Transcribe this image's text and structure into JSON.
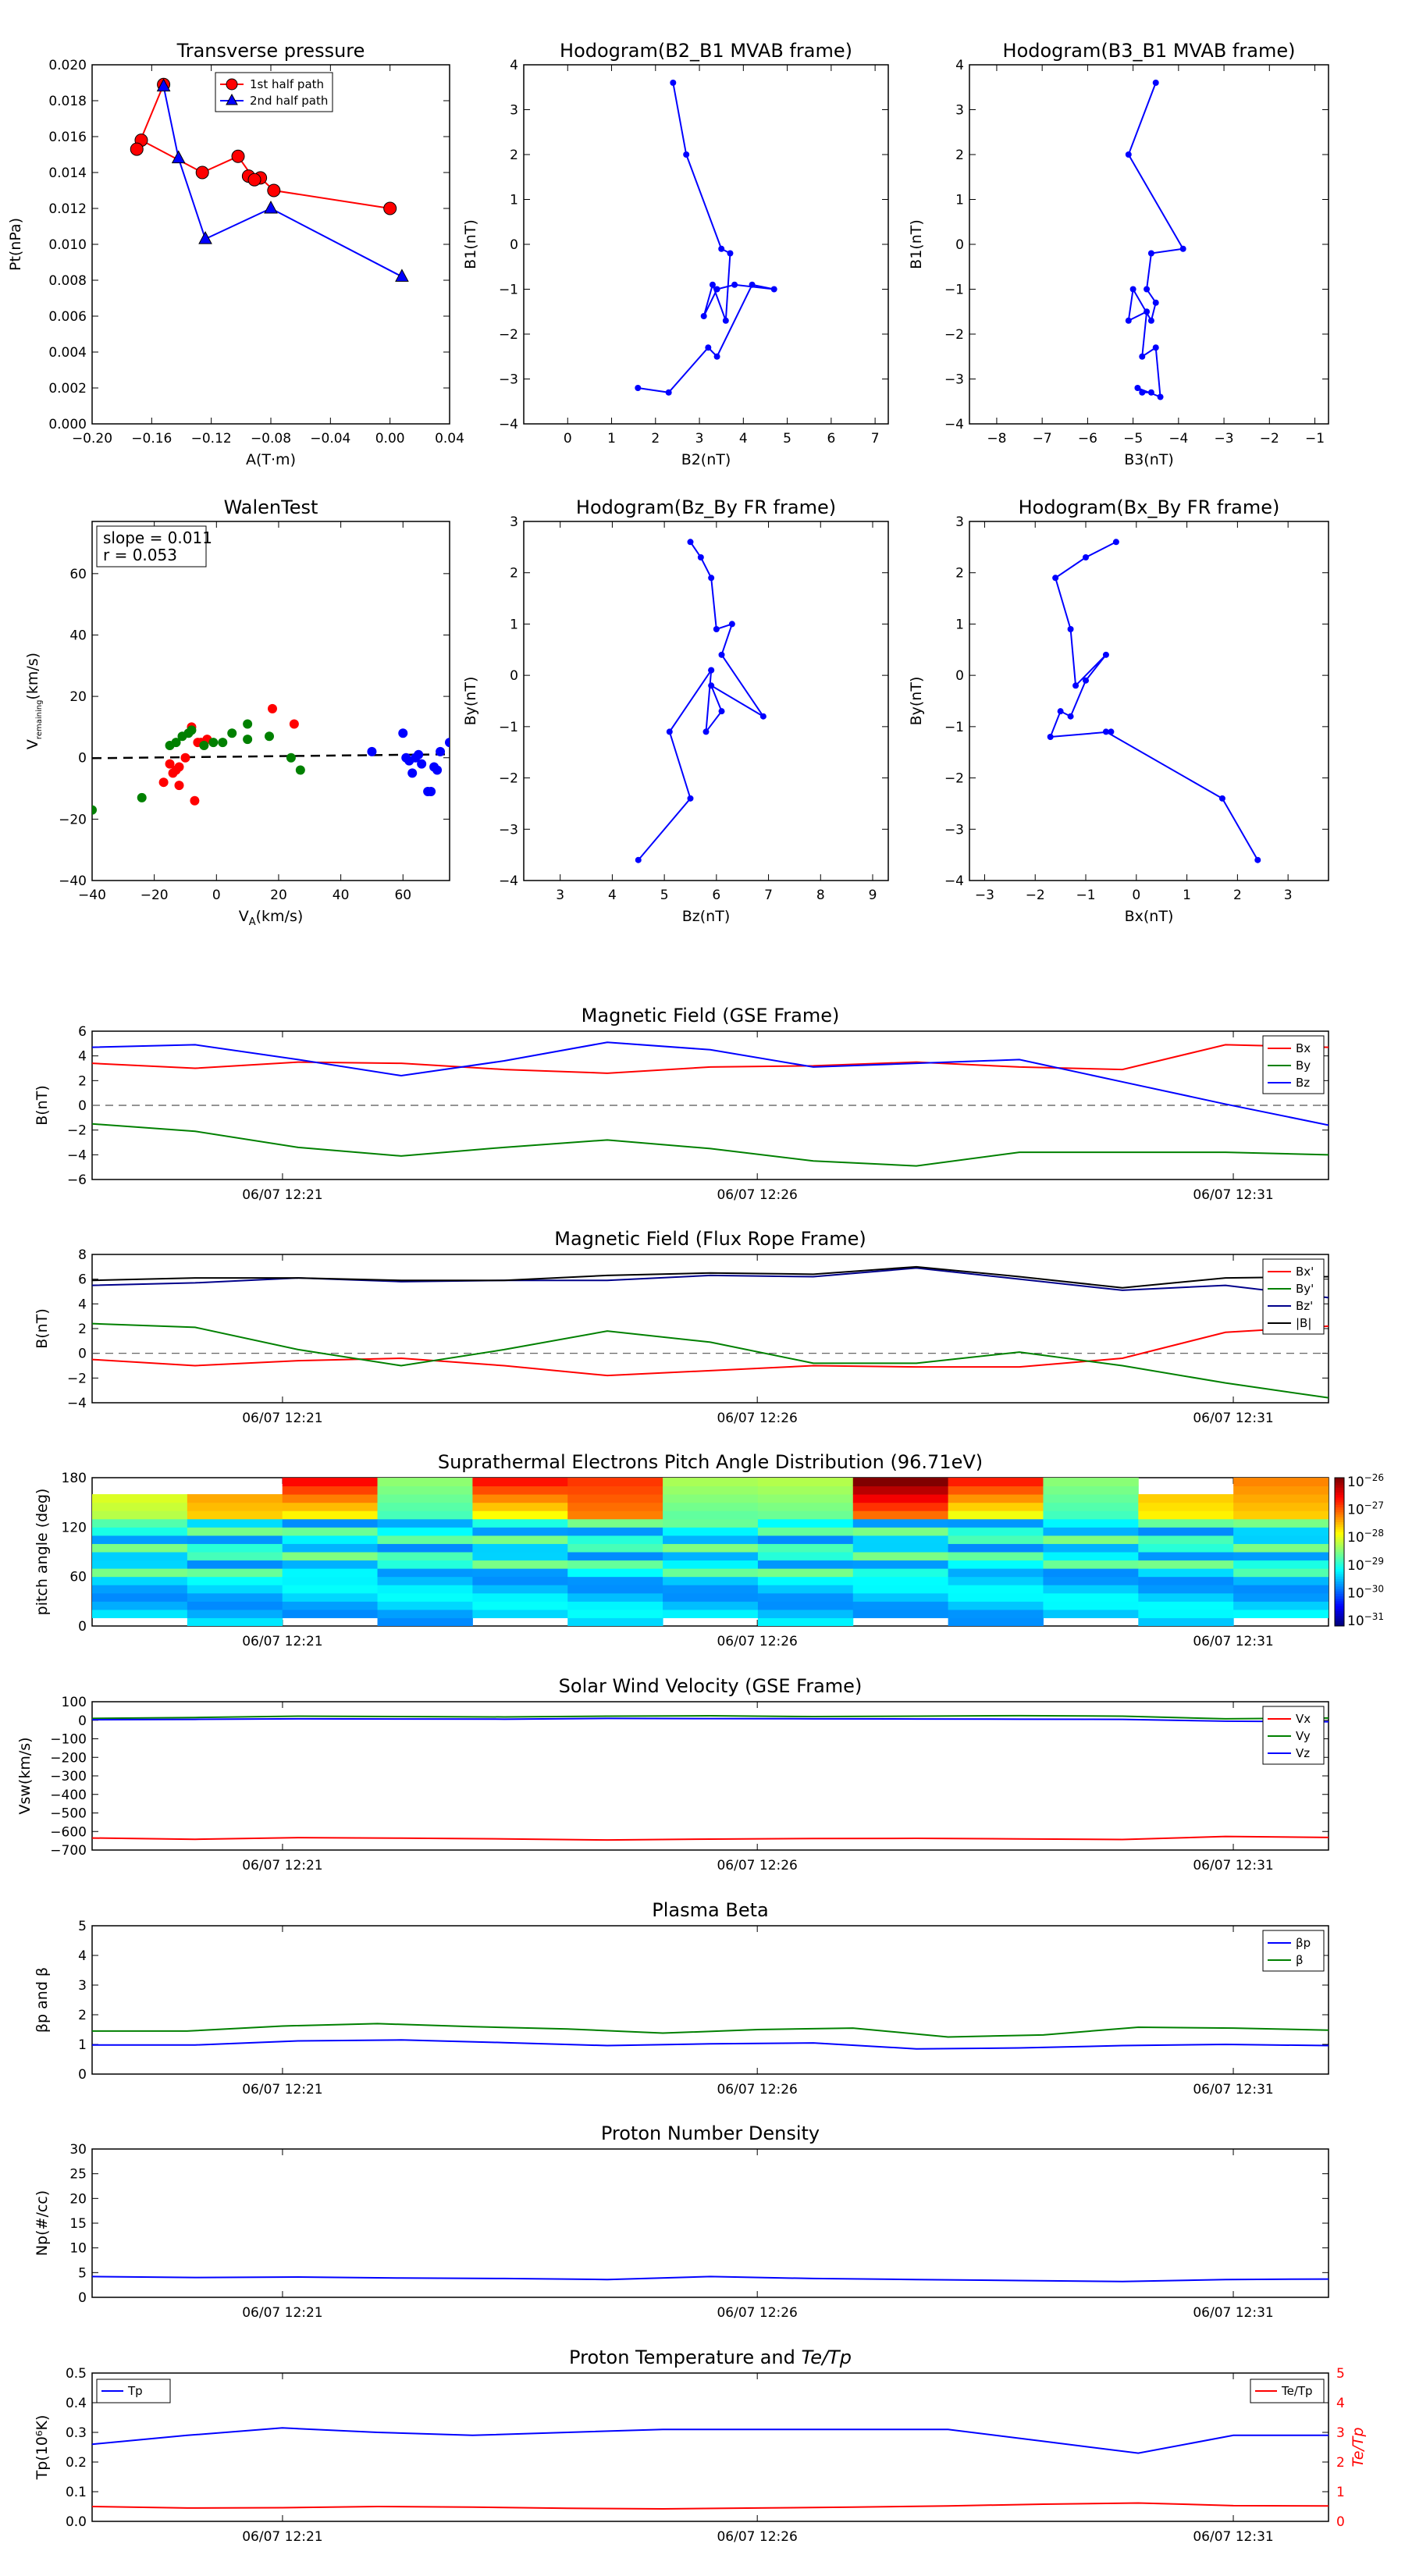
{
  "chart_data": [
    {
      "id": "tp",
      "type": "line",
      "title": "Transverse pressure",
      "xlabel": "A(T·m)",
      "ylabel": "Pt(nPa)",
      "xlim": [
        -0.2,
        0.04
      ],
      "ylim": [
        0,
        0.02
      ],
      "xticks": [
        "−0.20",
        "−0.16",
        "−0.12",
        "−0.08",
        "−0.04",
        "0.00",
        "0.04"
      ],
      "yticks": [
        "0.000",
        "0.002",
        "0.004",
        "0.006",
        "0.008",
        "0.010",
        "0.012",
        "0.014",
        "0.016",
        "0.018",
        "0.020"
      ],
      "legend": [
        "1st half path",
        "2nd half path"
      ],
      "series": [
        {
          "name": "1st half path",
          "color": "#ff0000",
          "marker": "circle",
          "x": [
            0.0,
            -0.078,
            -0.087,
            -0.095,
            -0.091,
            -0.102,
            -0.126,
            -0.167,
            -0.17,
            -0.152
          ],
          "y": [
            0.012,
            0.013,
            0.0137,
            0.0138,
            0.0136,
            0.0149,
            0.014,
            0.0158,
            0.0153,
            0.0189
          ]
        },
        {
          "name": "2nd half path",
          "color": "#0000ff",
          "marker": "triangle",
          "x": [
            -0.152,
            -0.142,
            -0.124,
            -0.08,
            0.008
          ],
          "y": [
            0.0188,
            0.0148,
            0.0103,
            0.012,
            0.0082
          ]
        }
      ]
    },
    {
      "id": "h1",
      "type": "line",
      "title": "Hodogram(B2_B1 MVAB frame)",
      "xlabel": "B2(nT)",
      "ylabel": "B1(nT)",
      "xlim": [
        -1,
        7.3
      ],
      "ylim": [
        -4,
        4
      ],
      "xticks": [
        "0",
        "1",
        "2",
        "3",
        "4",
        "5",
        "6",
        "7"
      ],
      "yticks": [
        "−4",
        "−3",
        "−2",
        "−1",
        "0",
        "1",
        "2",
        "3",
        "4"
      ],
      "series": [
        {
          "color": "#0000ff",
          "x": [
            2.4,
            2.7,
            3.5,
            3.7,
            3.6,
            3.3,
            3.1,
            3.4,
            3.8,
            4.7,
            4.2,
            3.4,
            3.2,
            2.3,
            1.6
          ],
          "y": [
            3.6,
            2.0,
            -0.1,
            -0.2,
            -1.7,
            -0.9,
            -1.6,
            -1.0,
            -0.9,
            -1.0,
            -0.9,
            -2.5,
            -2.3,
            -3.3,
            -3.2
          ]
        }
      ]
    },
    {
      "id": "h2",
      "type": "line",
      "title": "Hodogram(B3_B1 MVAB frame)",
      "xlabel": "B3(nT)",
      "ylabel": "B1(nT)",
      "xlim": [
        -8.6,
        -0.7
      ],
      "ylim": [
        -4,
        4
      ],
      "xticks": [
        "−8",
        "−7",
        "−6",
        "−5",
        "−4",
        "−3",
        "−2",
        "−1"
      ],
      "yticks": [
        "−4",
        "−3",
        "−2",
        "−1",
        "0",
        "1",
        "2",
        "3",
        "4"
      ],
      "series": [
        {
          "color": "#0000ff",
          "x": [
            -4.5,
            -5.1,
            -3.9,
            -4.6,
            -4.7,
            -4.5,
            -4.6,
            -5.0,
            -5.1,
            -4.7,
            -4.8,
            -4.5,
            -4.4,
            -4.9,
            -4.8,
            -4.6
          ],
          "y": [
            3.6,
            2.0,
            -0.1,
            -0.2,
            -1.0,
            -1.3,
            -1.7,
            -1.0,
            -1.7,
            -1.5,
            -2.5,
            -2.3,
            -3.4,
            -3.2,
            -3.3,
            -3.3
          ]
        }
      ]
    },
    {
      "id": "walen",
      "type": "scatter",
      "title": "WalenTest",
      "xlabel": "V",
      "xlabel_sub": "A",
      "xlabel_unit": "(km/s)",
      "ylabel": "V",
      "ylabel_sub": "remaining",
      "ylabel_unit": "(km/s)",
      "annotations": [
        "slope = 0.011",
        "r = 0.053"
      ],
      "xlim": [
        -40,
        75
      ],
      "ylim": [
        -40,
        77
      ],
      "xticks": [
        "−40",
        "−20",
        "0",
        "20",
        "40",
        "60"
      ],
      "yticks": [
        "−40",
        "−20",
        "0",
        "20",
        "40",
        "60"
      ],
      "fit": {
        "slope": 0.011,
        "intercept": 0.3
      },
      "series": [
        {
          "color": "#ff0000",
          "x": [
            -8,
            -17,
            -12,
            -14,
            -13,
            -15,
            -12,
            -10,
            -7,
            -5,
            -6,
            -3,
            18,
            25
          ],
          "y": [
            10,
            -8,
            -3,
            -5,
            -4,
            -2,
            -9,
            0,
            -14,
            5,
            5,
            6,
            16,
            11
          ]
        },
        {
          "color": "#008000",
          "x": [
            -40,
            -24,
            -15,
            -13,
            -11,
            -9,
            -8,
            -4,
            -1,
            2,
            5,
            10,
            10,
            17,
            24,
            27
          ],
          "y": [
            -17,
            -13,
            4,
            5,
            7,
            8,
            9,
            4,
            5,
            5,
            8,
            11,
            6,
            7,
            0,
            -4
          ]
        },
        {
          "color": "#0000ff",
          "x": [
            50,
            60,
            61,
            62,
            63,
            64,
            65,
            66,
            68,
            69,
            70,
            71,
            72,
            75,
            76
          ],
          "y": [
            2,
            8,
            0,
            -1,
            -5,
            0,
            1,
            -2,
            -11,
            -11,
            -3,
            -4,
            2,
            5,
            5
          ]
        }
      ]
    },
    {
      "id": "h3",
      "type": "line",
      "title": "Hodogram(Bz_By FR frame)",
      "xlabel": "Bz(nT)",
      "ylabel": "By(nT)",
      "xlim": [
        2.3,
        9.3
      ],
      "ylim": [
        -4,
        3
      ],
      "xticks": [
        "3",
        "4",
        "5",
        "6",
        "7",
        "8",
        "9"
      ],
      "yticks": [
        "−4",
        "−3",
        "−2",
        "−1",
        "0",
        "1",
        "2",
        "3"
      ],
      "series": [
        {
          "color": "#0000ff",
          "x": [
            5.5,
            5.7,
            5.9,
            6.0,
            6.3,
            6.1,
            6.9,
            5.9,
            6.1,
            5.8,
            5.9,
            5.9,
            5.1,
            5.5,
            4.5
          ],
          "y": [
            2.6,
            2.3,
            1.9,
            0.9,
            1.0,
            0.4,
            -0.8,
            -0.2,
            -0.7,
            -1.1,
            0.1,
            0.1,
            -1.1,
            -2.4,
            -3.6
          ]
        }
      ]
    },
    {
      "id": "h4",
      "type": "line",
      "title": "Hodogram(Bx_By FR frame)",
      "xlabel": "Bx(nT)",
      "ylabel": "By(nT)",
      "xlim": [
        -3.3,
        3.8
      ],
      "ylim": [
        -4,
        3
      ],
      "xticks": [
        "−3",
        "−2",
        "−1",
        "0",
        "1",
        "2",
        "3"
      ],
      "yticks": [
        "−4",
        "−3",
        "−2",
        "−1",
        "0",
        "1",
        "2",
        "3"
      ],
      "series": [
        {
          "color": "#0000ff",
          "x": [
            -0.4,
            -1.0,
            -1.6,
            -1.3,
            -1.2,
            -0.6,
            -1.0,
            -1.3,
            -1.5,
            -1.7,
            -0.5,
            -0.6,
            1.7,
            2.4
          ],
          "y": [
            2.6,
            2.3,
            1.9,
            0.9,
            -0.2,
            0.4,
            -0.1,
            -0.8,
            -0.7,
            -1.2,
            -1.1,
            -1.1,
            -2.4,
            -3.6
          ]
        }
      ]
    },
    {
      "id": "mag_gse",
      "type": "line",
      "title": "Magnetic Field (GSE Frame)",
      "ylabel": "B(nT)",
      "ylim": [
        -6,
        6
      ],
      "yticks": [
        "−6",
        "−4",
        "−2",
        "0",
        "2",
        "4",
        "6"
      ],
      "xticks": [
        "06/07 12:21",
        "06/07 12:26",
        "06/07 12:31"
      ],
      "zeroline": true,
      "legend": [
        "Bx",
        "By",
        "Bz"
      ],
      "series": [
        {
          "name": "Bx",
          "color": "#ff0000",
          "y": [
            3.4,
            3.0,
            3.5,
            3.4,
            2.9,
            2.6,
            3.1,
            3.2,
            3.5,
            3.1,
            2.9,
            4.9,
            4.7
          ]
        },
        {
          "name": "By",
          "color": "#008000",
          "y": [
            -1.5,
            -2.1,
            -3.4,
            -4.1,
            -3.4,
            -2.8,
            -3.5,
            -4.5,
            -4.9,
            -3.8,
            -3.8,
            -3.8,
            -4.0
          ]
        },
        {
          "name": "Bz",
          "color": "#0000ff",
          "y": [
            4.7,
            4.9,
            3.7,
            2.4,
            3.6,
            5.1,
            4.5,
            3.1,
            3.4,
            3.7,
            1.9,
            0.1,
            -1.6
          ]
        }
      ]
    },
    {
      "id": "mag_fr",
      "type": "line",
      "title": "Magnetic Field (Flux Rope Frame)",
      "ylabel": "B(nT)",
      "ylim": [
        -4,
        8
      ],
      "yticks": [
        "−4",
        "−2",
        "0",
        "2",
        "4",
        "6",
        "8"
      ],
      "xticks": [
        "06/07 12:21",
        "06/07 12:26",
        "06/07 12:31"
      ],
      "zeroline": true,
      "legend": [
        "Bx'",
        "By'",
        "Bz'",
        "|B|"
      ],
      "series": [
        {
          "name": "Bx'",
          "color": "#ff0000",
          "y": [
            -0.5,
            -1.0,
            -0.6,
            -0.4,
            -1.0,
            -1.8,
            -1.4,
            -1.0,
            -1.1,
            -1.1,
            -0.4,
            1.7,
            2.2
          ]
        },
        {
          "name": "By'",
          "color": "#008000",
          "y": [
            2.4,
            2.1,
            0.3,
            -1.0,
            0.3,
            1.8,
            0.9,
            -0.8,
            -0.8,
            0.1,
            -1.0,
            -2.4,
            -3.6
          ]
        },
        {
          "name": "Bz'",
          "color": "#00008b",
          "y": [
            5.5,
            5.7,
            6.1,
            5.8,
            5.9,
            5.9,
            6.3,
            6.2,
            6.9,
            6.0,
            5.1,
            5.5,
            4.5
          ]
        },
        {
          "name": "|B|",
          "color": "#000000",
          "y": [
            5.9,
            6.1,
            6.1,
            5.9,
            5.9,
            6.3,
            6.5,
            6.4,
            7.0,
            6.2,
            5.3,
            6.1,
            6.2
          ]
        }
      ]
    },
    {
      "id": "pad",
      "type": "heatmap",
      "title": "Suprathermal Electrons Pitch Angle Distribution (96.71eV)",
      "ylabel": "pitch angle (deg)",
      "ylim": [
        0,
        180
      ],
      "yticks": [
        "0",
        "60",
        "120",
        "180"
      ],
      "xticks": [
        "06/07 12:21",
        "06/07 12:26",
        "06/07 12:31"
      ],
      "colorbar": {
        "base": "10",
        "exponents": [
          "−26",
          "−27",
          "−28",
          "−29",
          "−30",
          "−31"
        ]
      },
      "columns": 13,
      "rows": 18
    },
    {
      "id": "vsw",
      "type": "line",
      "title": "Solar Wind Velocity (GSE Frame)",
      "ylabel": "Vsw(km/s)",
      "ylim": [
        -700,
        100
      ],
      "yticks": [
        "−700",
        "−600",
        "−500",
        "−400",
        "−300",
        "−200",
        "−100",
        "0",
        "100"
      ],
      "xticks": [
        "06/07 12:21",
        "06/07 12:26",
        "06/07 12:31"
      ],
      "legend": [
        "Vx",
        "Vy",
        "Vz"
      ],
      "series": [
        {
          "name": "Vx",
          "color": "#ff0000",
          "y": [
            -635,
            -642,
            -633,
            -636,
            -640,
            -646,
            -641,
            -638,
            -637,
            -640,
            -643,
            -627,
            -632
          ]
        },
        {
          "name": "Vy",
          "color": "#008000",
          "y": [
            10,
            15,
            22,
            20,
            18,
            22,
            24,
            20,
            22,
            25,
            22,
            8,
            12
          ]
        },
        {
          "name": "Vz",
          "color": "#0000ff",
          "y": [
            3,
            5,
            8,
            7,
            6,
            10,
            9,
            8,
            7,
            6,
            5,
            -5,
            -8
          ]
        }
      ]
    },
    {
      "id": "beta",
      "type": "line",
      "title": "Plasma Beta",
      "ylabel": "βp and β",
      "ylim": [
        0,
        5
      ],
      "yticks": [
        "0",
        "1",
        "2",
        "3",
        "4",
        "5"
      ],
      "xticks": [
        "06/07 12:21",
        "06/07 12:26",
        "06/07 12:31"
      ],
      "legend": [
        "βp",
        "β"
      ],
      "series": [
        {
          "name": "βp",
          "color": "#0000ff",
          "y": [
            0.98,
            0.98,
            1.12,
            1.15,
            1.06,
            0.96,
            1.02,
            1.05,
            0.85,
            0.88,
            0.96,
            1.0,
            0.96
          ]
        },
        {
          "name": "β",
          "color": "#008000",
          "y": [
            1.45,
            1.45,
            1.62,
            1.7,
            1.6,
            1.52,
            1.38,
            1.5,
            1.55,
            1.25,
            1.32,
            1.58,
            1.55,
            1.48
          ]
        }
      ]
    },
    {
      "id": "np",
      "type": "line",
      "title": "Proton Number Density",
      "ylabel": "Np(#/cc)",
      "ylim": [
        0,
        30
      ],
      "yticks": [
        "0",
        "5",
        "10",
        "15",
        "20",
        "25",
        "30"
      ],
      "xticks": [
        "06/07 12:21",
        "06/07 12:26",
        "06/07 12:31"
      ],
      "series": [
        {
          "color": "#0000ff",
          "y": [
            4.2,
            4.0,
            4.1,
            3.9,
            3.8,
            3.6,
            4.2,
            3.8,
            3.6,
            3.4,
            3.2,
            3.6,
            3.7
          ]
        }
      ]
    },
    {
      "id": "temp",
      "type": "line",
      "title": "Proton Temperature and",
      "title_math": "Te/Tp",
      "ylabel": "Tp(10⁶K)",
      "ylabel_right": "Te/Tp",
      "ylim": [
        0,
        0.5
      ],
      "ylim_right": [
        0,
        5
      ],
      "yticks": [
        "0.0",
        "0.1",
        "0.2",
        "0.3",
        "0.4",
        "0.5"
      ],
      "yticks_right": [
        "0",
        "1",
        "2",
        "3",
        "4",
        "5"
      ],
      "xticks": [
        "06/07 12:21",
        "06/07 12:26",
        "06/07 12:31"
      ],
      "legend": [
        "Tp",
        "Te/Tp"
      ],
      "series": [
        {
          "name": "Tp",
          "color": "#0000ff",
          "y": [
            0.26,
            0.29,
            0.315,
            0.3,
            0.29,
            0.3,
            0.31,
            0.31,
            0.31,
            0.31,
            0.27,
            0.23,
            0.29,
            0.29
          ]
        },
        {
          "name": "Te/Tp",
          "color": "#ff0000",
          "axis": "right",
          "y": [
            0.5,
            0.45,
            0.46,
            0.5,
            0.48,
            0.44,
            0.42,
            0.45,
            0.48,
            0.52,
            0.58,
            0.62,
            0.53,
            0.52
          ]
        }
      ]
    }
  ]
}
